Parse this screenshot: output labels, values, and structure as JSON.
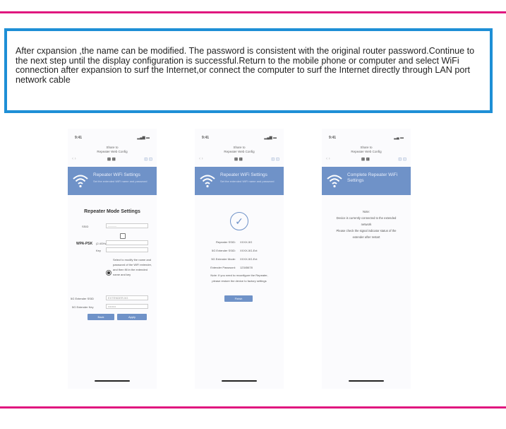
{
  "description_text": "After cxpansion ,the name can be modified. The password is consistent with the original router password.Continue to the next step until the display configuration is successful.Return to the mobile phone or computer and select WiFi connection after expansion to surf the Internet,or connect the computer to surf the Internet directly through LAN port network cable",
  "colors": {
    "accent_pink": "#e0177f",
    "accent_blue": "#1e8fd6",
    "banner_blue": "#6f92c8"
  },
  "phones": [
    {
      "status_time": "9:41",
      "status_signal": "▂▄▆ ▬",
      "url_line1": "Share to",
      "url_line2": "Repeater Web Config",
      "nav_left": "‹ ›",
      "nav_mid": "⊞ ⊞",
      "nav_right": "⊡ ⊡",
      "banner_title": "Repeater WiFi Settings",
      "banner_sub": "Set the extended WiFi name and password",
      "title": "Repeater Mode Settings",
      "ssid_label": "SSID",
      "ssid_value": "———",
      "wpa_label": "WPA-PSK",
      "wpa_note": "(2.4GHz)",
      "key_label": "Key",
      "radio_note": "Select to modify the name and password of the WiFi extender, and then fill in the extended name and key",
      "ext_ssid_label": "5G Extender SSID",
      "ext_ssid_value": "EXTENDER-5G",
      "ext_key_label": "5G Extender Key",
      "ext_key_value": "••••••••",
      "btn_prev": "Back",
      "btn_next": "Apply"
    },
    {
      "status_time": "9:41",
      "status_signal": "▂▄▆ ▬",
      "url_line1": "Share to",
      "url_line2": "Repeater Web Config",
      "nav_left": "‹ ›",
      "nav_mid": "⊞ ⊞",
      "nav_right": "⊡ ⊡",
      "banner_title": "Repeater WiFi Settings",
      "banner_sub": "Set the extended WiFi name and password",
      "check_symbol": "✓",
      "rows": [
        {
          "k": "Repeater SSID:",
          "v": "XXXX-5G"
        },
        {
          "k": "5G Extender SSID:",
          "v": "XXXX-5G-Ext"
        },
        {
          "k": "5G Extender Mode:",
          "v": "XXXX-5G-Ext"
        },
        {
          "k": "Extender Password:",
          "v": "12345678"
        }
      ],
      "note1": "Note: If you need to reconfigure the Repeater,",
      "note2": "please restore the device to factory settings",
      "btn": "Finish"
    },
    {
      "status_time": "9:41",
      "status_signal": "▂▄ ▬",
      "url_line1": "Share to",
      "url_line2": "Repeater Web Config",
      "nav_left": "‹ ›",
      "nav_mid": "⊞ ⊞",
      "nav_right": "⊡ ⊡",
      "banner_title": "Complete Repeater WiFi Settings",
      "line1": "Note:",
      "line2": "Device is currently connected to the extended",
      "line3": "network",
      "line4": "Please check the signal indicator status of the",
      "line5": "extender after restart"
    }
  ]
}
